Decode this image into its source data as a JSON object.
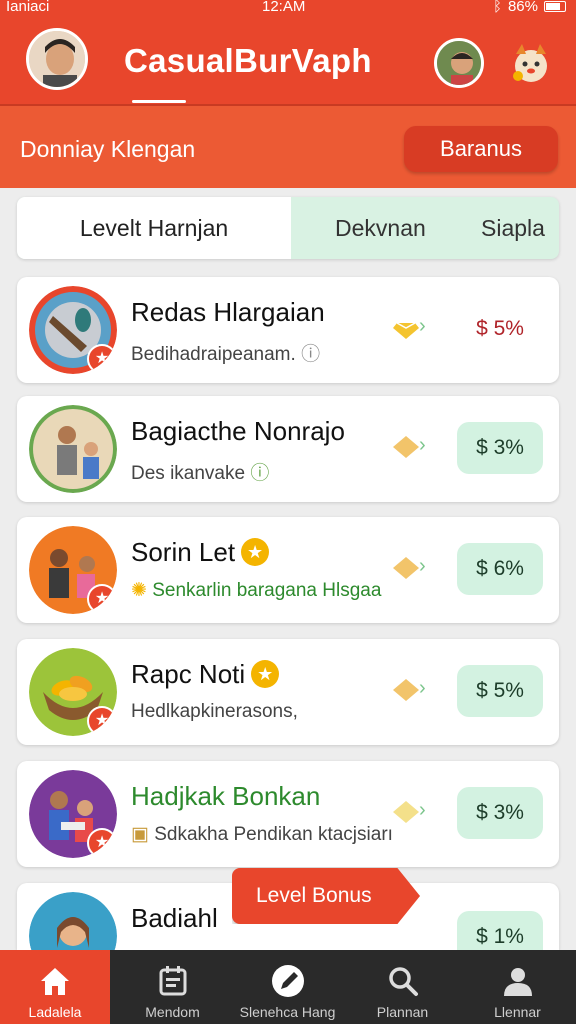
{
  "status_bar": {
    "left": "Ianiaci",
    "time": "12:AM",
    "battery": "86%"
  },
  "app": {
    "title": "CasualBurVaph"
  },
  "subheader": {
    "title": "Donniay Klengan",
    "bonus_button": "Baranus"
  },
  "tabs": [
    {
      "label": "Levelt Harnjan",
      "active": true
    },
    {
      "label": "Dekvnan",
      "active": false
    },
    {
      "label": "Siapla",
      "active": false
    }
  ],
  "cards": [
    {
      "name": "Redas Hlargaian",
      "desc": "Bedihadraipeanam.",
      "price": "$ 5%"
    },
    {
      "name": "Bagiacthe Nonrajo",
      "desc": "Des ikanvake",
      "price": "$ 3%"
    },
    {
      "name": "Sorin Let",
      "desc": "Senkarlin baragana Hlsgaa",
      "price": "$ 6%"
    },
    {
      "name": "Rapc Noti",
      "desc": "Hedlkapkinerasons,",
      "price": "$ 5%"
    },
    {
      "name": "Hadjkak Bonkan",
      "desc": "Sdkakha Pendikan ktacjsiarı",
      "price": "$ 3%"
    },
    {
      "name": "Badiahl",
      "desc": "",
      "price": "$ 1%"
    }
  ],
  "level_bonus": "Level Bonus",
  "bottom_nav": [
    {
      "label": "Ladalela",
      "icon": "home-icon",
      "active": true
    },
    {
      "label": "Mendom",
      "icon": "calendar-icon",
      "active": false
    },
    {
      "label": "Slenehca Hang",
      "icon": "pencil-icon",
      "active": false
    },
    {
      "label": "Plannan",
      "icon": "search-icon",
      "active": false
    },
    {
      "label": "Llennar",
      "icon": "profile-icon",
      "active": false
    }
  ],
  "colors": {
    "brand": "#e8462c",
    "price_bg": "#d3f2e1",
    "nav_bg": "#2a2a2a"
  }
}
